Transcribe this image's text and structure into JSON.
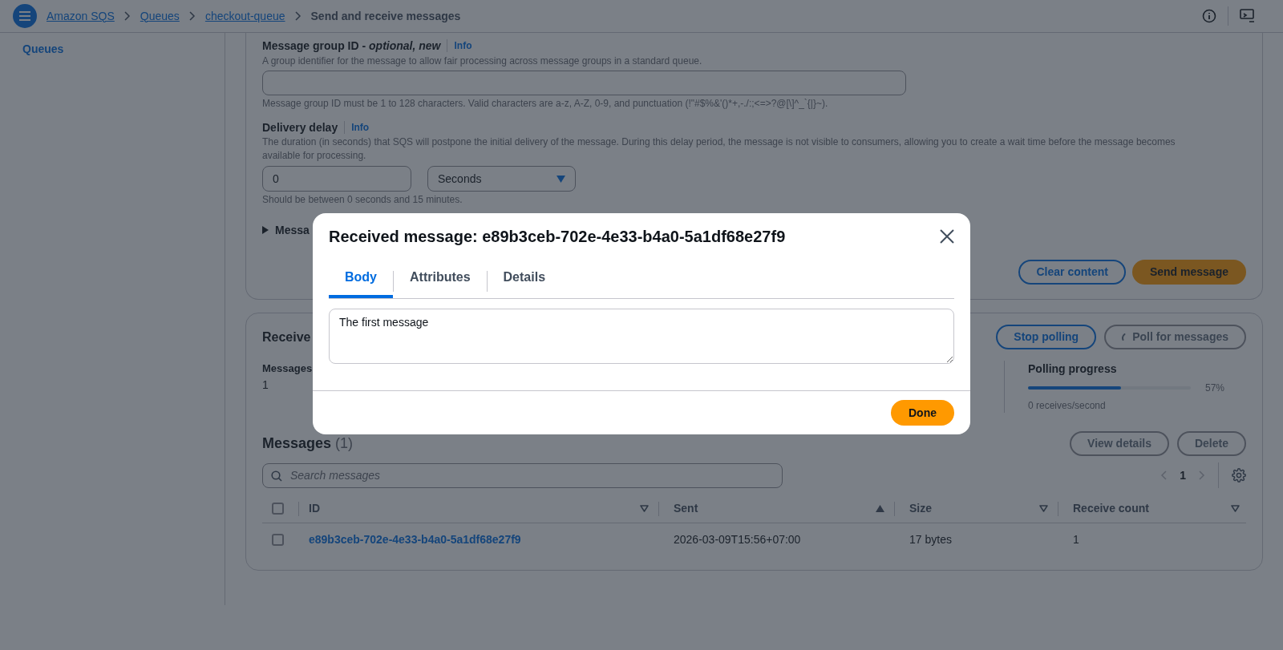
{
  "top_bar": {
    "breadcrumbs": [
      {
        "label": "Amazon SQS",
        "current": false
      },
      {
        "label": "Queues",
        "current": false
      },
      {
        "label": "checkout-queue",
        "current": false
      },
      {
        "label": "Send and receive messages",
        "current": true
      }
    ]
  },
  "sidebar": {
    "items": [
      {
        "label": "Queues"
      }
    ]
  },
  "send_form": {
    "group_id": {
      "label": "Message group ID - *optional, new*",
      "info": "Info",
      "description": "A group identifier for the message to allow fair processing across message groups in a standard queue.",
      "hint": "Message group ID must be 1 to 128 characters. Valid characters are a-z, A-Z, 0-9, and punctuation (!\"#$%&'()*+,-./:;<=>?@[\\]^_`{|}~)."
    },
    "delivery_delay": {
      "label": "Delivery delay",
      "info": "Info",
      "description": "The duration (in seconds) that SQS will postpone the initial delivery of the message. During this delay period, the message is not visible to consumers, allowing you to create a wait time before the message becomes available for processing.",
      "value": "0",
      "unit": "Seconds",
      "hint": "Should be between 0 seconds and 15 minutes."
    },
    "attributes_toggle": {
      "label": "Messa",
      "expanded": false
    },
    "buttons": [
      {
        "label": "Clear content",
        "kind": "secondary"
      },
      {
        "label": "Send message",
        "kind": "primary"
      }
    ]
  },
  "receive_panel": {
    "title": "Receive",
    "buttons": [
      {
        "label": "Stop polling",
        "disabled": false,
        "loading": false
      },
      {
        "label": "Poll for messages",
        "disabled": true,
        "loading": true
      }
    ],
    "stat": {
      "label": "Messages",
      "value": "1"
    },
    "polling": {
      "label": "Polling progress",
      "level": 0.57,
      "reading": "57%",
      "rate": "0 receives/second"
    }
  },
  "messages": {
    "title": "Messages",
    "count": "(1)",
    "buttons": [
      {
        "label": "View details",
        "disabled": true
      },
      {
        "label": "Delete",
        "disabled": true
      }
    ],
    "search": {
      "placeholder": "Search messages"
    },
    "page": "1",
    "select_all": {
      "checked": false
    },
    "columns": [
      {
        "label": "ID",
        "sorted": false
      },
      {
        "label": "Sent",
        "sorted": true
      },
      {
        "label": "Size",
        "sorted": false
      },
      {
        "label": "Receive count",
        "sorted": false
      }
    ],
    "rows": [
      {
        "checked": false,
        "cells": [
          "e89b3ceb-702e-4e33-b4a0-5a1df68e27f9",
          "2026-03-09T15:56+07:00",
          "17 bytes",
          "1"
        ]
      }
    ]
  },
  "modal": {
    "title": "Received message: e89b3ceb-702e-4e33-b4a0-5a1df68e27f9",
    "tabs": [
      {
        "label": "Body",
        "selected": true
      },
      {
        "label": "Attributes",
        "selected": false
      },
      {
        "label": "Details",
        "selected": false
      }
    ],
    "body": "The first message",
    "buttons": [
      "Done"
    ]
  }
}
